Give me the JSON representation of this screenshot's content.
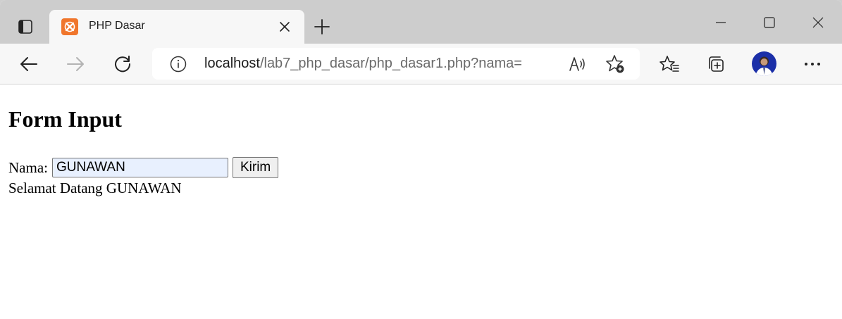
{
  "browser": {
    "tab": {
      "title": "PHP Dasar",
      "favicon": "xampp-icon",
      "favicon_color": "#f0762c"
    },
    "address": {
      "host": "localhost",
      "path": "/lab7_php_dasar/php_dasar1.php?nama="
    },
    "icons": {
      "tab_actions": "tab-actions-icon",
      "close_tab": "close-icon",
      "new_tab": "plus-icon",
      "minimize": "minimize-icon",
      "maximize": "maximize-icon",
      "close_window": "close-window-icon",
      "back": "back-arrow-icon",
      "forward": "forward-arrow-icon",
      "refresh": "refresh-icon",
      "site_info": "info-icon",
      "read_aloud": "read-aloud-icon",
      "add_favorite": "add-favorite-icon",
      "favorites": "favorites-icon",
      "collections": "collections-icon",
      "profile": "avatar",
      "more": "more-icon"
    }
  },
  "page": {
    "heading": "Form Input",
    "form": {
      "label": "Nama:",
      "input_value": "GUNAWAN",
      "submit_label": "Kirim"
    },
    "welcome_text": "Selamat Datang GUNAWAN"
  }
}
